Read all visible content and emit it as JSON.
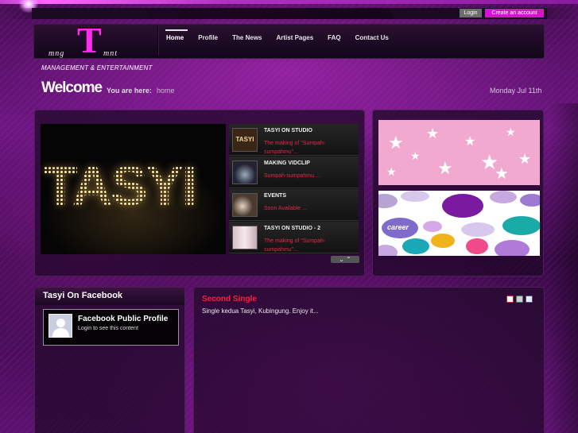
{
  "top": {
    "login_label": "Login",
    "create_account_label": "Create an account"
  },
  "logo": {
    "left": "mng",
    "letter": "T",
    "right": "mnt",
    "tagline": "MANAGEMENT & ENTERTAINMENT"
  },
  "nav": {
    "items": [
      "Home",
      "Profile",
      "The News",
      "Artist Pages",
      "FAQ",
      "Contact Us"
    ],
    "active": "Home"
  },
  "page": {
    "heading": "Welcome",
    "you_are_here_label": "You are here:",
    "breadcrumb": "home",
    "date": "Monday Jul 11th"
  },
  "slider": {
    "main_text": "TASYI",
    "items": [
      {
        "title": "TASYI ON STUDIO",
        "desc": "The making of \"Sumpah-sumpahmu\"...",
        "thumb": "TASYI"
      },
      {
        "title": "MAKING VIDCLIP",
        "desc": "Sumpah-sumpahmu ..."
      },
      {
        "title": "EVENTS",
        "desc": "Soon Available ..."
      },
      {
        "title": "TASYI ON STUDIO - 2",
        "desc": "The making of \"Sumpah-sumpahmu\"..."
      }
    ],
    "arrows": "⌄ ⌃"
  },
  "banners": {
    "career_label": "career"
  },
  "facebook": {
    "title": "Tasyi On Facebook",
    "profile_name": "Facebook Public Profile",
    "login_text": "Login to see this content"
  },
  "article": {
    "title": "Second Single",
    "text": "Single kedua Tasyi, Kubingung. Enjoy it..."
  },
  "colors": {
    "accent": "#d016c8",
    "logo_pink": "#ff2cf0",
    "article_title": "#ff1e3c",
    "slider_desc": "#e0294a"
  }
}
